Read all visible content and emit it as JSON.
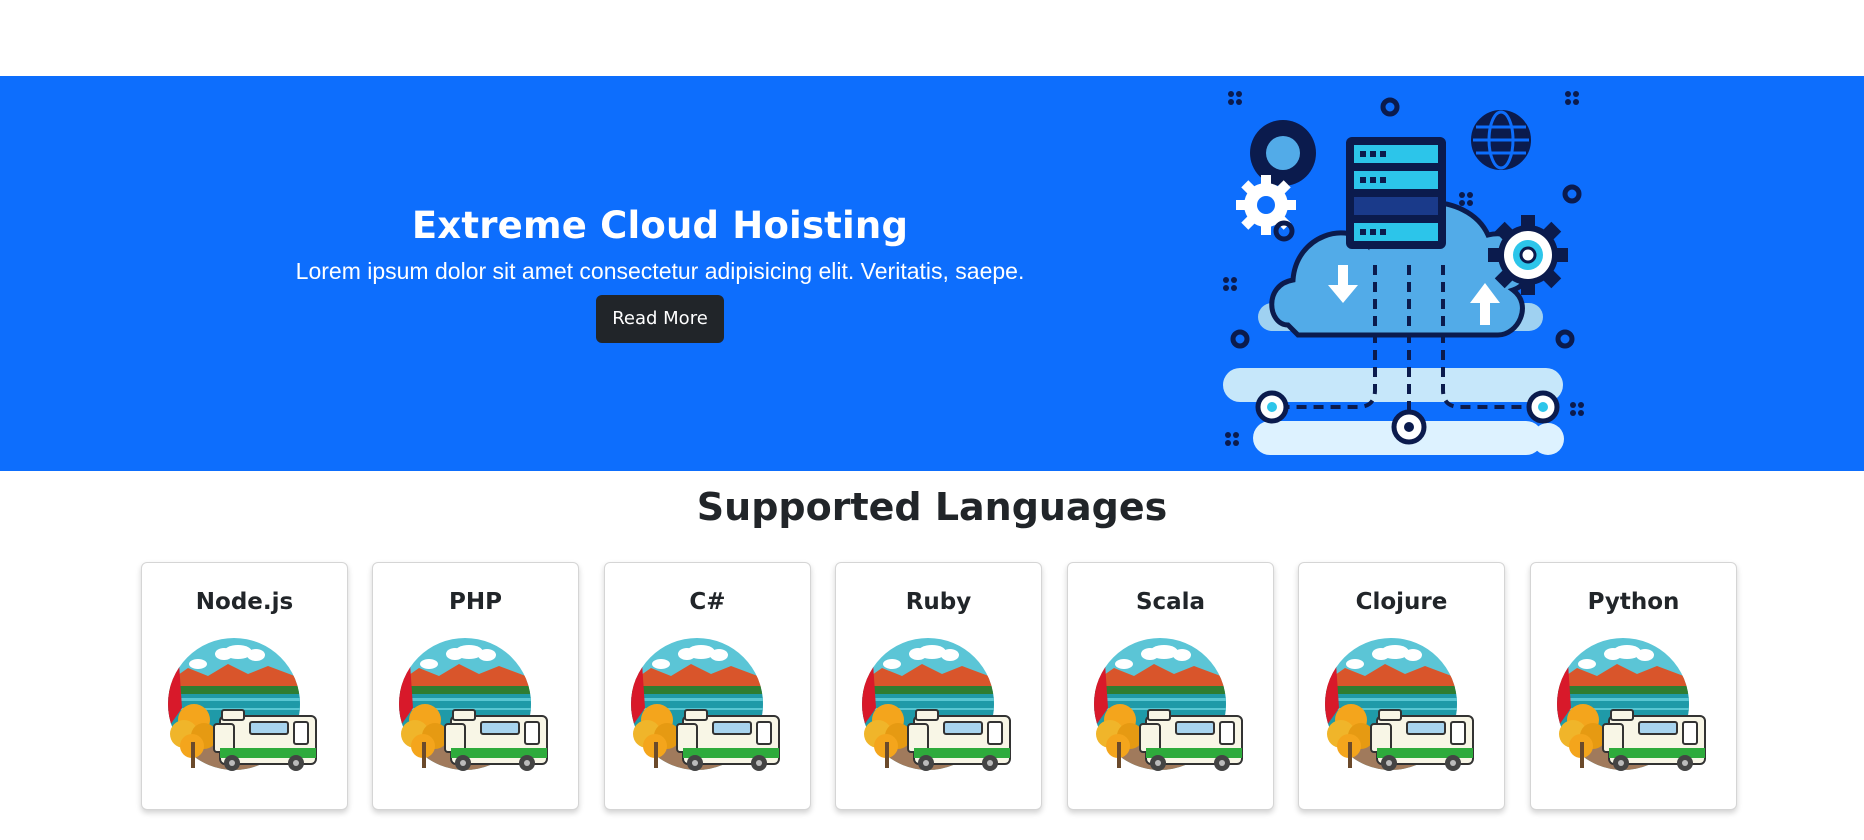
{
  "hero": {
    "title": "Extreme Cloud Hoisting",
    "subtitle": "Lorem ipsum dolor sit amet consectetur adipisicing elit. Veritatis, saepe.",
    "button_label": "Read More",
    "illustration": "cloud-server-illustration"
  },
  "languages": {
    "heading": "Supported Languages",
    "items": [
      {
        "name": "Node.js",
        "image": "camper-van-landscape-image"
      },
      {
        "name": "PHP",
        "image": "camper-van-landscape-image"
      },
      {
        "name": "C#",
        "image": "camper-van-landscape-image"
      },
      {
        "name": "Ruby",
        "image": "camper-van-landscape-image"
      },
      {
        "name": "Scala",
        "image": "camper-van-landscape-image"
      },
      {
        "name": "Clojure",
        "image": "camper-van-landscape-image"
      },
      {
        "name": "Python",
        "image": "camper-van-landscape-image"
      }
    ]
  },
  "colors": {
    "hero_background": "#0d6efd",
    "button_background": "#212529",
    "text_dark": "#212529"
  }
}
